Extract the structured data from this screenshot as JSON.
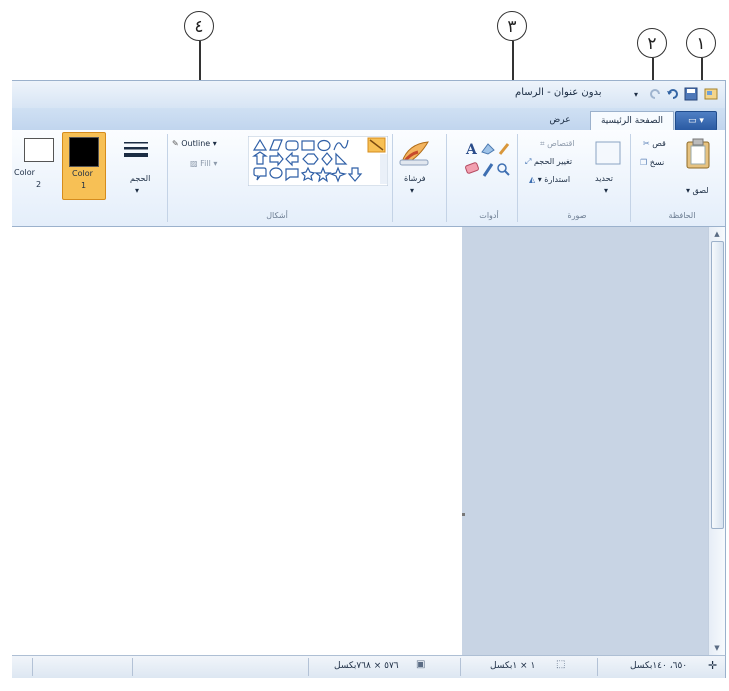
{
  "callouts": [
    "١",
    "٢",
    "٣",
    "٤"
  ],
  "window": {
    "title": "بدون عنوان - الرسام",
    "file_button": "▾"
  },
  "tabs": [
    {
      "label": "الصفحة الرئيسية",
      "active": true
    },
    {
      "label": "عرض",
      "active": false
    }
  ],
  "ribbon": {
    "clipboard": {
      "label": "الحافظة",
      "paste": "لصق ▾",
      "cut": "قص",
      "copy": "نسخ"
    },
    "image": {
      "label": "صورة",
      "select": "تحديد",
      "crop": "اقتصاص",
      "resize": "تغيير الحجم",
      "rotate": "استدارة ▾"
    },
    "tools": {
      "label": "أدوات"
    },
    "brushes": {
      "label": "فرشاة"
    },
    "shapes": {
      "label": "أشكال",
      "outline": "▾ Outline",
      "fill": "▾ Fill"
    },
    "size": {
      "label": "الحجم"
    },
    "color1": {
      "label": "Color",
      "index": "1"
    },
    "color2": {
      "label": "Color",
      "index": "2"
    }
  },
  "status": {
    "cursor_pos": "٦٥٠، ١٤٠بكسل",
    "selection_size": "١ × ١بكسل",
    "image_size": "٥٧٦ × ٧٦٨بكسل"
  },
  "colors": {
    "color1": "#000000",
    "color2": "#ffffff",
    "accent_orange": "#f7c055",
    "ribbon_blue": "#c1d5ee"
  }
}
